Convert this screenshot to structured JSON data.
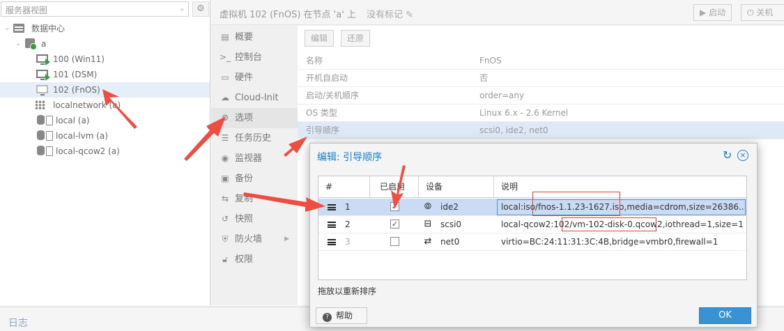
{
  "tree": {
    "view_select": "服务器视图",
    "items": [
      {
        "label": "数据中心"
      },
      {
        "label": "a"
      },
      {
        "label": "100 (Win11)"
      },
      {
        "label": "101 (DSM)"
      },
      {
        "label": "102 (FnOS)"
      },
      {
        "label": "localnetwork (a)"
      },
      {
        "label": "local (a)"
      },
      {
        "label": "local-lvm (a)"
      },
      {
        "label": "local-qcow2 (a)"
      }
    ]
  },
  "header": {
    "title": "虚拟机 102 (FnOS) 在节点 'a' 上",
    "tags": "没有标记",
    "start_button": "启动",
    "shutdown_button": "关机"
  },
  "subnav": {
    "items": [
      {
        "label": "概要"
      },
      {
        "label": "控制台"
      },
      {
        "label": "硬件"
      },
      {
        "label": "Cloud-Init"
      },
      {
        "label": "选项"
      },
      {
        "label": "任务历史"
      },
      {
        "label": "监视器"
      },
      {
        "label": "备份"
      },
      {
        "label": "复制"
      },
      {
        "label": "快照"
      },
      {
        "label": "防火墙"
      },
      {
        "label": "权限"
      }
    ]
  },
  "options": {
    "toolbar": {
      "edit": "编辑",
      "revert": "还原"
    },
    "rows": [
      {
        "key": "名称",
        "value": "FnOS"
      },
      {
        "key": "开机自启动",
        "value": "否"
      },
      {
        "key": "启动/关机顺序",
        "value": "order=any"
      },
      {
        "key": "OS 类型",
        "value": "Linux 6.x - 2.6 Kernel"
      },
      {
        "key": "引导顺序",
        "value": "scsi0, ide2, net0"
      }
    ]
  },
  "log_bar": {
    "label": "日志"
  },
  "dialog": {
    "title": "编辑: 引导顺序",
    "columns": {
      "order": "#",
      "enabled": "已启用",
      "device": "设备",
      "description": "说明"
    },
    "rows": [
      {
        "order": "1",
        "enabled": true,
        "device": "ide2",
        "device_icon": "cdrom-icon",
        "description": "local:iso/fnos-1.1.23-1627.iso,media=cdrom,size=26386..."
      },
      {
        "order": "2",
        "enabled": true,
        "device": "scsi0",
        "device_icon": "hard-disk-icon",
        "description": "local-qcow2:102/vm-102-disk-0.qcow2,iothread=1,size=1..."
      },
      {
        "order": "3",
        "enabled": false,
        "device": "net0",
        "device_icon": "network-icon",
        "description": "virtio=BC:24:11:31:3C:4B,bridge=vmbr0,firewall=1"
      }
    ],
    "drag_hint": "拖放以重新排序",
    "help_button": "帮助",
    "ok_button": "OK"
  },
  "colors": {
    "accent": "#157fcc",
    "ok_button": "#3892d4",
    "selection": "#c9dcf3",
    "annotation": "#e0403a"
  }
}
